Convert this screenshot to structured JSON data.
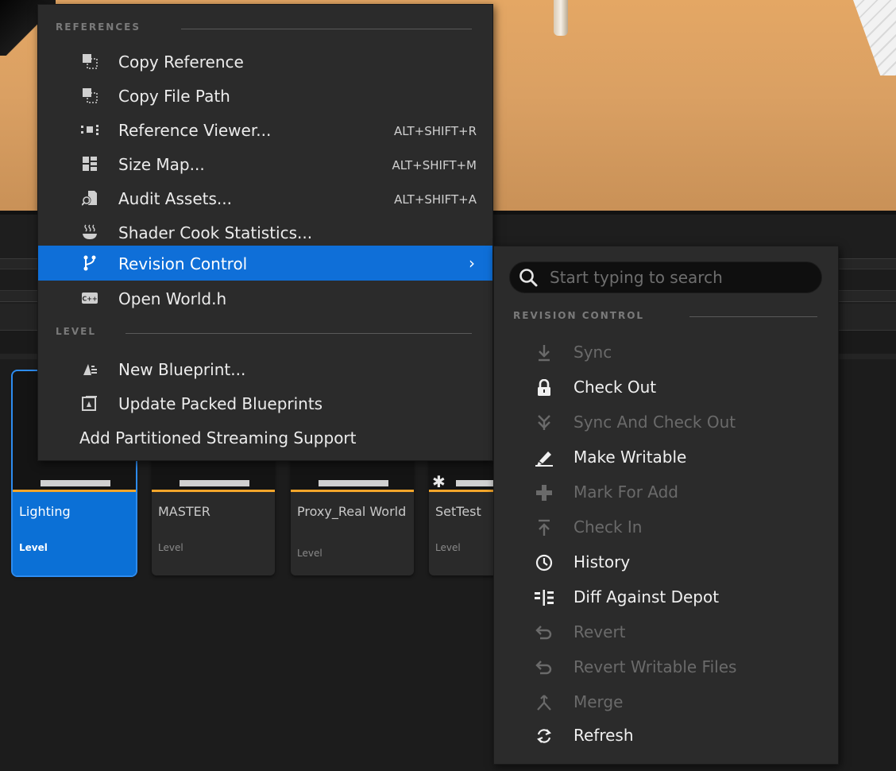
{
  "context_menu": {
    "sections": [
      {
        "title": "REFERENCES",
        "items": [
          {
            "label": "Copy Reference",
            "icon": "copy-reference-icon",
            "shortcut": ""
          },
          {
            "label": "Copy File Path",
            "icon": "copy-file-path-icon",
            "shortcut": ""
          },
          {
            "label": "Reference Viewer...",
            "icon": "reference-viewer-icon",
            "shortcut": "ALT+SHIFT+R"
          },
          {
            "label": "Size Map...",
            "icon": "size-map-icon",
            "shortcut": "ALT+SHIFT+M"
          },
          {
            "label": "Audit Assets...",
            "icon": "audit-assets-icon",
            "shortcut": "ALT+SHIFT+A"
          },
          {
            "label": "Shader Cook Statistics...",
            "icon": "shader-cook-icon",
            "shortcut": ""
          },
          {
            "label": "Revision Control",
            "icon": "revision-control-icon",
            "shortcut": "",
            "has_submenu": true,
            "highlighted": true
          },
          {
            "label": "Open World.h",
            "icon": "cpp-file-icon",
            "shortcut": ""
          }
        ]
      },
      {
        "title": "LEVEL",
        "items": [
          {
            "label": "New Blueprint...",
            "icon": "new-blueprint-icon"
          },
          {
            "label": "Update Packed Blueprints",
            "icon": "update-packed-blueprints-icon"
          },
          {
            "label": "Add Partitioned Streaming Support",
            "icon": ""
          }
        ]
      }
    ]
  },
  "submenu": {
    "search_placeholder": "Start typing to search",
    "section_title": "REVISION CONTROL",
    "items": [
      {
        "label": "Sync",
        "icon": "sync-icon",
        "enabled": false
      },
      {
        "label": "Check Out",
        "icon": "lock-icon",
        "enabled": true
      },
      {
        "label": "Sync And Check Out",
        "icon": "sync-and-check-out-icon",
        "enabled": false
      },
      {
        "label": "Make Writable",
        "icon": "pencil-icon",
        "enabled": true
      },
      {
        "label": "Mark For Add",
        "icon": "plus-icon",
        "enabled": false
      },
      {
        "label": "Check In",
        "icon": "check-in-icon",
        "enabled": false
      },
      {
        "label": "History",
        "icon": "clock-icon",
        "enabled": true
      },
      {
        "label": "Diff Against Depot",
        "icon": "diff-icon",
        "enabled": true
      },
      {
        "label": "Revert",
        "icon": "revert-icon",
        "enabled": false
      },
      {
        "label": "Revert Writable Files",
        "icon": "revert-writable-icon",
        "enabled": false
      },
      {
        "label": "Merge",
        "icon": "merge-icon",
        "enabled": false
      },
      {
        "label": "Refresh",
        "icon": "refresh-icon",
        "enabled": true
      }
    ]
  },
  "assets": [
    {
      "name": "Lighting",
      "type": "Level",
      "selected": true
    },
    {
      "name": "MASTER",
      "type": "Level",
      "selected": false
    },
    {
      "name": "Proxy_Real World",
      "type": "Level",
      "selected": false
    },
    {
      "name": "SetTest",
      "type": "Level",
      "selected": false,
      "modified": true
    }
  ],
  "colors": {
    "highlight": "#0f6fd8",
    "tile_selected": "#0b70d6",
    "level_accent": "#f2a52b",
    "menu_bg": "#2b2b2b"
  }
}
